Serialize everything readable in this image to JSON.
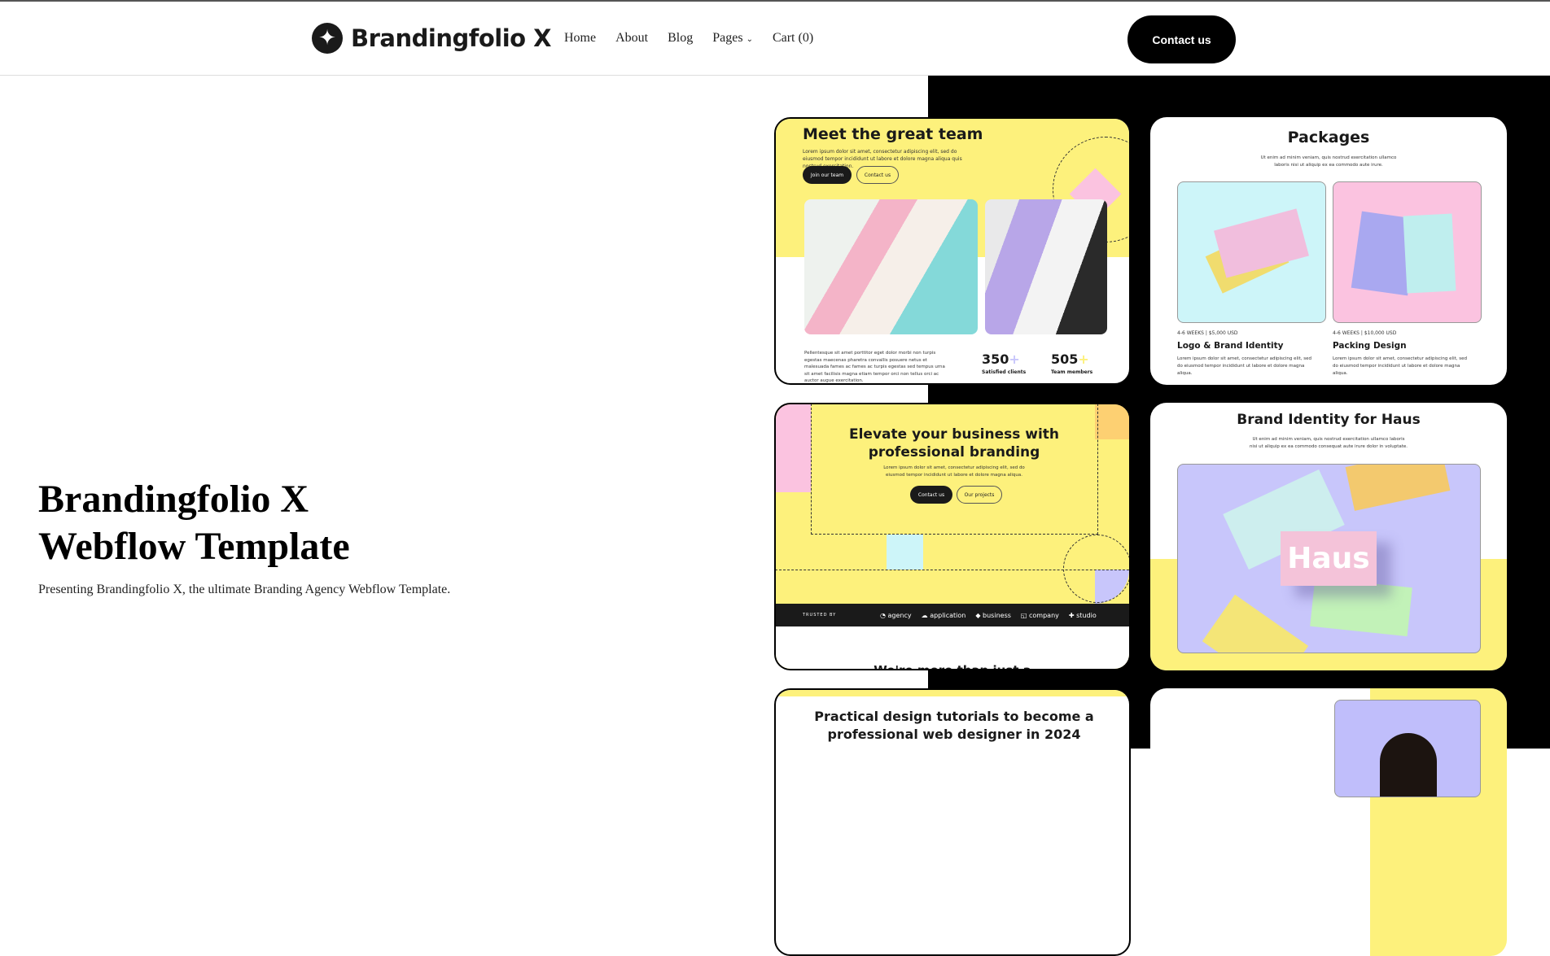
{
  "nav": {
    "brand": "Brandingfolio X",
    "links": [
      "Home",
      "About",
      "Blog",
      "Pages",
      "Cart (0)"
    ],
    "cta": "Contact us"
  },
  "hero": {
    "title_line1": "Brandingfolio X",
    "title_line2": "Webflow Template",
    "subtitle": "Presenting Brandingfolio X, the ultimate Branding Agency Webflow Template."
  },
  "cards": {
    "team": {
      "title": "Meet the great team",
      "text": "Lorem ipsum dolor sit amet, consectetur adipiscing elit, sed do eiusmod tempor incididunt ut labore et dolore magna aliqua quis nostrud exercitation.",
      "btn1": "Join our team",
      "btn2": "Contact us",
      "para": "Pellentesque sit amet porttitor eget dolor morbi non turpis egestas maecenas pharetra convallis posuere netus et malesuada fames ac fames ac turpis egestas sed tempus urna sit amet facilisis magna etiam tempor orci non tellus orci ac auctor augue exercitation.",
      "stat1": "350",
      "stat1_label": "Satisfied clients",
      "stat2": "505",
      "stat2_label": "Team members"
    },
    "packages": {
      "title": "Packages",
      "text": "Ut enim ad minim veniam, quis nostrud exercitation ullamco laboris nisi ut aliquip ex ea commodo aute irure.",
      "items": [
        {
          "meta1": "4-6 WEEKS",
          "meta2": "$5,000 USD",
          "name": "Logo & Brand Identity",
          "desc": "Lorem ipsum dolor sit amet, consectetur adipiscing elit, sed do eiusmod tempor incididunt ut labore et dolore magna aliqua."
        },
        {
          "meta1": "4-6 WEEKS",
          "meta2": "$10,000 USD",
          "name": "Packing Design",
          "desc": "Lorem ipsum dolor sit amet, consectetur adipiscing elit, sed do eiusmod tempor incididunt ut labore et dolore magna aliqua."
        }
      ]
    },
    "elevate": {
      "title": "Elevate your business with professional branding",
      "text": "Lorem ipsum dolor sit amet, consectetur adipiscing elit, sed do eiusmod tempor incididunt ut labore et dolore magna aliqua.",
      "btn1": "Contact us",
      "btn2": "Our projects",
      "trusted": "TRUSTED BY",
      "logos": [
        "agency",
        "application",
        "business",
        "company",
        "studio"
      ],
      "next": "We're more than just a"
    },
    "haus": {
      "title": "Brand Identity for Haus",
      "text": "Ut enim ad minim veniam, quis nostrud exercitation ullamco laboris nisi ut aliquip ex ea commodo consequat aute irure dolor in voluptate.",
      "word": "Haus"
    },
    "blog": {
      "title": "Practical design tutorials to become a professional web designer in 2024"
    }
  },
  "colors": {
    "yellow": "#fdf17c",
    "pink": "#fbc3e0",
    "cyan": "#cdf5f9",
    "lavender": "#c8c6fb",
    "dark": "#1a1a1a"
  }
}
